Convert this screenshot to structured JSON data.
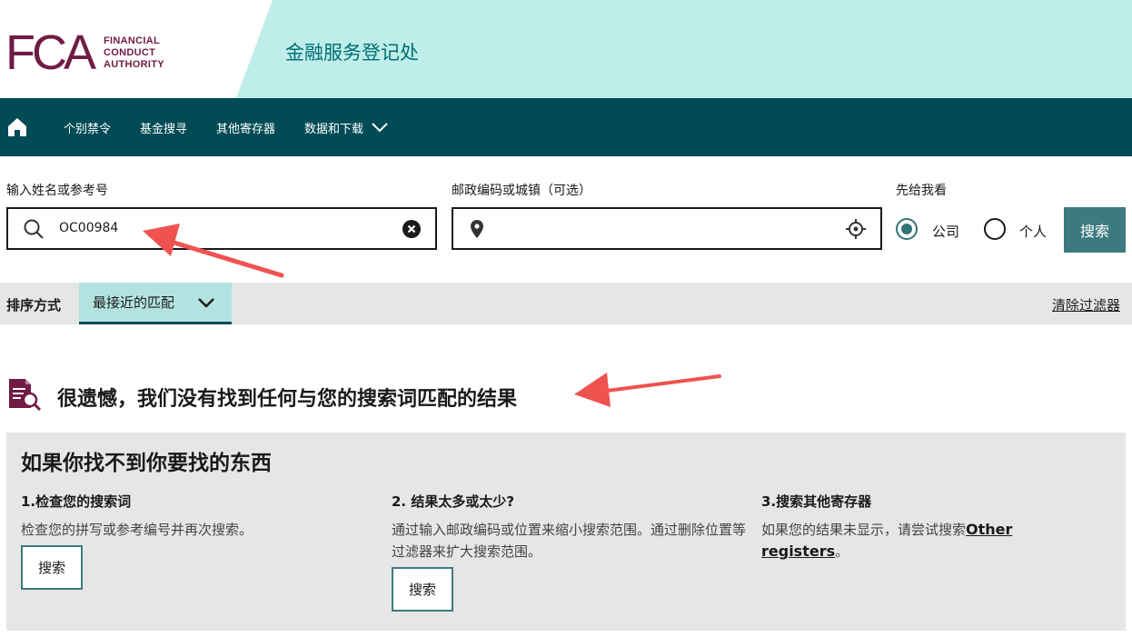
{
  "header": {
    "logo_mark": "FCA",
    "logo_text": [
      "FINANCIAL",
      "CONDUCT",
      "AUTHORITY"
    ],
    "site_title": "金融服务登记处"
  },
  "nav": {
    "items": [
      {
        "label": "个别禁令"
      },
      {
        "label": "基金搜寻"
      },
      {
        "label": "其他寄存器"
      },
      {
        "label": "数据和下载"
      }
    ]
  },
  "search": {
    "name_label": "输入姓名或参考号",
    "name_value": "OC00984",
    "location_label": "邮政编码或城镇（可选）",
    "show_label": "先给我看",
    "option_firm": "公司",
    "option_person": "个人",
    "selected": "公司",
    "button_label": "搜索"
  },
  "sort": {
    "label": "排序方式",
    "selected": "最接近的匹配",
    "clear_filters": "清除过滤器"
  },
  "results": {
    "no_results_message": "很遗憾，我们没有找到任何与您的搜索词匹配的结果"
  },
  "help": {
    "title": "如果你找不到你要找的东西",
    "columns": [
      {
        "heading": "1.检查您的搜索词",
        "text": "检查您的拼写或参考编号并再次搜索。",
        "button": "搜索"
      },
      {
        "heading": "2. 结果太多或太少?",
        "text": "通过输入邮政编码或位置来缩小搜索范围。通过删除位置等过滤器来扩大搜索范围。",
        "button": "搜索"
      },
      {
        "heading": "3.搜索其他寄存器",
        "text": "如果您的结果未显示，请尝试搜索",
        "link": "Other registers",
        "suffix": "。"
      }
    ]
  },
  "colors": {
    "brand": "#701b45",
    "nav": "#004b55",
    "header_bg": "#bfeeea",
    "accent": "#3d7a80",
    "annotation_arrow": "#ef5350"
  }
}
